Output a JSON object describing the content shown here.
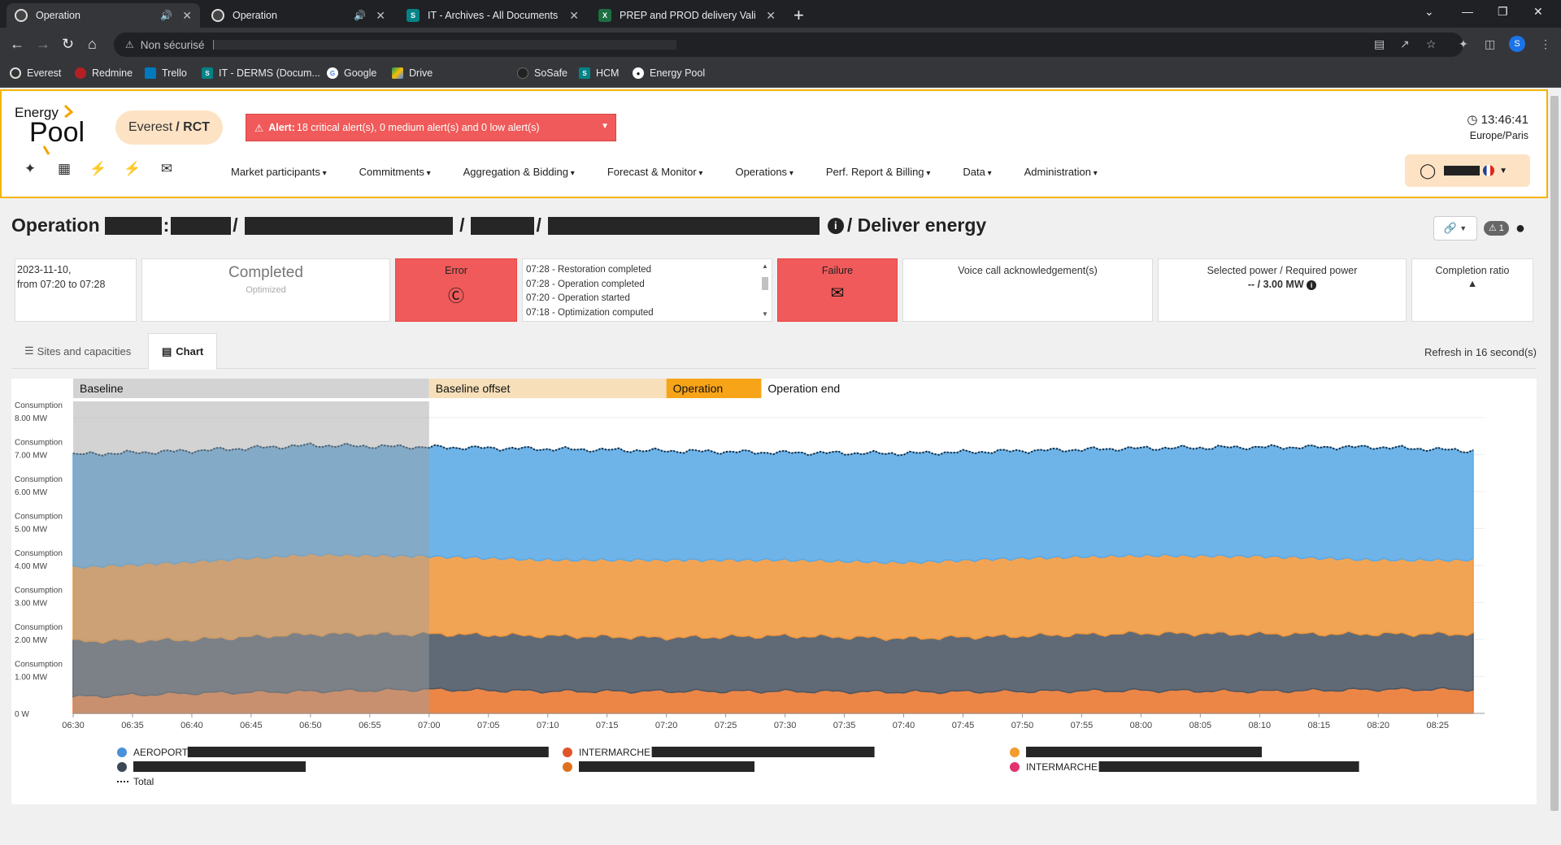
{
  "browser": {
    "tabs": [
      {
        "title": "Operation",
        "icon": "energy-pool-favicon",
        "audio": true,
        "active": true
      },
      {
        "title": "Operation",
        "icon": "energy-pool-favicon",
        "audio": true,
        "active": false
      },
      {
        "title": "IT - Archives - All Documents",
        "icon": "sharepoint-favicon",
        "audio": false,
        "active": false
      },
      {
        "title": "PREP and PROD delivery Validat",
        "icon": "excel-favicon",
        "audio": false,
        "active": false
      }
    ],
    "security_label": "Non sécurisé",
    "profile_initial": "S",
    "bookmarks": [
      "Everest",
      "Redmine",
      "Trello",
      "IT - DERMS (Docum...",
      "Google",
      "Drive",
      "SoSafe",
      "HCM",
      "Energy Pool"
    ]
  },
  "header": {
    "logo_text_top": "Energy",
    "logo_text_bottom": "Pool",
    "env_name": "Everest",
    "env_suffix": "/ RCT",
    "alert_strong": "Alert:",
    "alert_text": "18 critical alert(s), 0 medium alert(s) and 0 low alert(s)",
    "clock_time": "13:46:41",
    "clock_tz": "Europe/Paris",
    "menu": [
      "Market participants",
      "Commitments",
      "Aggregation & Bidding",
      "Forecast & Monitor",
      "Operations",
      "Perf. Report & Billing",
      "Data",
      "Administration"
    ],
    "quick_icons": [
      "magic-wand-icon",
      "calendar-icon",
      "flash-clock-icon",
      "flash-magic-icon",
      "envelope-icon"
    ],
    "accent_color": "#f4b400"
  },
  "operation": {
    "title_prefix": "Operation",
    "title_suffix": "/ Deliver energy",
    "date": "2023-11-10,",
    "time_range": "from 07:20 to 07:28",
    "status": "Completed",
    "status_sub": "Optimized",
    "error_label": "Error",
    "log": [
      "07:28 - Restoration completed",
      "07:28 - Operation completed",
      "07:20 - Operation started",
      "07:18 - Optimization computed"
    ],
    "failure_label": "Failure",
    "voice_label": "Voice call acknowledgement(s)",
    "power_label": "Selected power / Required power",
    "power_value": "-- / 3.00 MW",
    "completion_label": "Completion ratio",
    "warn_count": "1",
    "error_color": "#f05a5a"
  },
  "tabs": {
    "sites": "Sites and capacities",
    "chart": "Chart",
    "refresh": "Refresh in 16 second(s)"
  },
  "chart_data": {
    "type": "area",
    "phases": [
      {
        "label": "Baseline",
        "start": "06:30",
        "end": "07:00",
        "color": "#d3d3d3"
      },
      {
        "label": "Baseline offset",
        "start": "07:00",
        "end": "07:20",
        "color": "#f6dfb9"
      },
      {
        "label": "Operation",
        "start": "07:20",
        "end": "07:28",
        "color": "#f7a418"
      },
      {
        "label": "Operation end",
        "start": "07:28",
        "end": "08:28",
        "color": "#ffffff"
      }
    ],
    "x_ticks": [
      "06:30",
      "06:35",
      "06:40",
      "06:45",
      "06:50",
      "06:55",
      "07:00",
      "07:05",
      "07:10",
      "07:15",
      "07:20",
      "07:25",
      "07:30",
      "07:35",
      "07:40",
      "07:45",
      "07:50",
      "07:55",
      "08:00",
      "08:05",
      "08:10",
      "08:15",
      "08:20",
      "08:25"
    ],
    "y_ticks": [
      {
        "value": 0,
        "label": "0 W",
        "title": ""
      },
      {
        "value": 1,
        "label": "1.00 MW",
        "title": "Consumption"
      },
      {
        "value": 2,
        "label": "2.00 MW",
        "title": "Consumption"
      },
      {
        "value": 3,
        "label": "3.00 MW",
        "title": "Consumption"
      },
      {
        "value": 4,
        "label": "4.00 MW",
        "title": "Consumption"
      },
      {
        "value": 5,
        "label": "5.00 MW",
        "title": "Consumption"
      },
      {
        "value": 6,
        "label": "6.00 MW",
        "title": "Consumption"
      },
      {
        "value": 7,
        "label": "7.00 MW",
        "title": "Consumption"
      },
      {
        "value": 8,
        "label": "8.00 MW",
        "title": "Consumption"
      }
    ],
    "ylim": [
      0,
      8
    ],
    "x_unit": "minutes from 06:30",
    "x_range": [
      0,
      118
    ],
    "series": [
      {
        "name": "",
        "color": "#e8752e",
        "points": [
          [
            0,
            0.45
          ],
          [
            10,
            0.55
          ],
          [
            20,
            0.6
          ],
          [
            30,
            0.65
          ],
          [
            40,
            0.6
          ],
          [
            50,
            0.6
          ],
          [
            60,
            0.6
          ],
          [
            70,
            0.58
          ],
          [
            80,
            0.6
          ],
          [
            90,
            0.62
          ],
          [
            100,
            0.6
          ],
          [
            110,
            0.65
          ],
          [
            118,
            0.65
          ]
        ]
      },
      {
        "name": "",
        "color": "#4a5563",
        "points": [
          [
            0,
            1.5
          ],
          [
            10,
            1.45
          ],
          [
            20,
            1.55
          ],
          [
            30,
            1.5
          ],
          [
            40,
            1.5
          ],
          [
            50,
            1.45
          ],
          [
            60,
            1.5
          ],
          [
            70,
            1.45
          ],
          [
            80,
            1.5
          ],
          [
            90,
            1.55
          ],
          [
            100,
            1.55
          ],
          [
            110,
            1.5
          ],
          [
            118,
            1.5
          ]
        ]
      },
      {
        "name": "",
        "color": "#f0973d",
        "points": [
          [
            0,
            2.0
          ],
          [
            10,
            2.1
          ],
          [
            20,
            2.15
          ],
          [
            30,
            2.1
          ],
          [
            40,
            2.05
          ],
          [
            50,
            2.1
          ],
          [
            60,
            2.05
          ],
          [
            70,
            2.05
          ],
          [
            80,
            2.1
          ],
          [
            90,
            2.1
          ],
          [
            100,
            2.1
          ],
          [
            110,
            2.0
          ],
          [
            118,
            2.0
          ]
        ]
      },
      {
        "name": "",
        "color": "#5aaae6",
        "points": [
          [
            0,
            3.05
          ],
          [
            10,
            3.0
          ],
          [
            20,
            2.95
          ],
          [
            30,
            2.95
          ],
          [
            40,
            3.0
          ],
          [
            50,
            2.95
          ],
          [
            60,
            2.9
          ],
          [
            70,
            2.95
          ],
          [
            80,
            2.9
          ],
          [
            90,
            2.9
          ],
          [
            100,
            2.95
          ],
          [
            110,
            3.05
          ],
          [
            118,
            2.95
          ]
        ]
      }
    ],
    "total_name": "Total",
    "legend": [
      {
        "label": "AEROPORT",
        "color": "#4a90d9"
      },
      {
        "label": "INTERMARCHE",
        "color": "#e2552b"
      },
      {
        "label": "",
        "color": "#f39c2f"
      },
      {
        "label": "",
        "color": "#3c4756"
      },
      {
        "label": "",
        "color": "#e0711b"
      },
      {
        "label": "INTERMARCHE",
        "color": "#e3336c"
      },
      {
        "label": "Total",
        "color": "#222222"
      }
    ]
  }
}
